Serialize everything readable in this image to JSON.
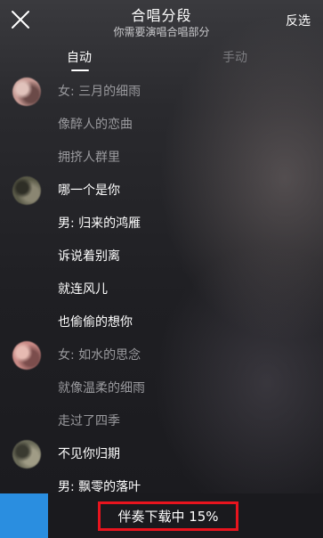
{
  "header": {
    "title": "合唱分段",
    "subtitle": "你需要演唱合唱部分",
    "invert_label": "反选",
    "close_icon": "close-icon"
  },
  "tabs": [
    {
      "label": "自动",
      "active": true
    },
    {
      "label": "手动",
      "active": false
    }
  ],
  "lyrics": [
    {
      "text": "女: 三月的细雨",
      "style": "dim",
      "avatar": true,
      "avatar_colors": [
        "#c79a94",
        "#6b4a48",
        "#e0c2bb"
      ]
    },
    {
      "text": "像醉人的恋曲",
      "style": "dim",
      "avatar": false
    },
    {
      "text": "拥挤人群里",
      "style": "dim",
      "avatar": false
    },
    {
      "text": "哪一个是你",
      "style": "bright",
      "avatar": true,
      "avatar_colors": [
        "#5a5a48",
        "#8a8672",
        "#2e2e26"
      ]
    },
    {
      "text": "男: 归来的鸿雁",
      "style": "bright",
      "avatar": false
    },
    {
      "text": "诉说着别离",
      "style": "bright",
      "avatar": false
    },
    {
      "text": "就连风儿",
      "style": "bright",
      "avatar": false
    },
    {
      "text": "也偷偷的想你",
      "style": "bright",
      "avatar": false
    },
    {
      "text": "女: 如水的思念",
      "style": "dim",
      "avatar": true,
      "avatar_colors": [
        "#c98a86",
        "#7b4d4c",
        "#e6bab2"
      ]
    },
    {
      "text": "就像温柔的细雨",
      "style": "dim",
      "avatar": false
    },
    {
      "text": "走过了四季",
      "style": "dim",
      "avatar": false
    },
    {
      "text": "不见你归期",
      "style": "bright",
      "avatar": true,
      "avatar_colors": [
        "#6a6a58",
        "#a09c86",
        "#3a3a30"
      ]
    },
    {
      "text": "男: 飘零的落叶",
      "style": "bright",
      "avatar": false
    }
  ],
  "footer": {
    "download_label": "伴奏下载中 15%",
    "progress": 0.15,
    "accent_color": "#2a8ee0",
    "highlight_color": "#e8141e"
  }
}
